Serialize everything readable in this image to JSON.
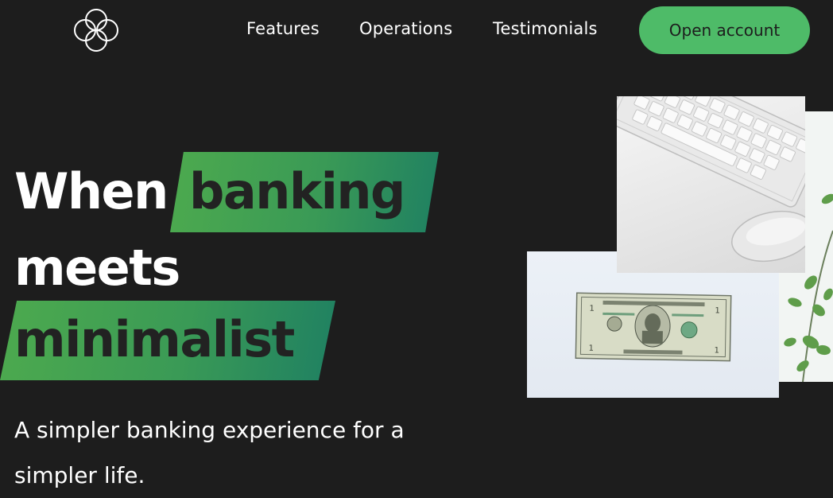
{
  "nav": {
    "logo_icon": "four-petal-logo-icon",
    "links": [
      "Features",
      "Operations",
      "Testimonials"
    ],
    "cta_label": "Open account"
  },
  "hero": {
    "word1": "When",
    "word2": "banking",
    "word3": "meets",
    "word4": "minimalist",
    "subtitle": "A simpler banking experience for a simpler life.",
    "accent_gradient": [
      "#4daa4e",
      "#1f8062"
    ]
  },
  "images": [
    "keyboard-mouse-photo",
    "dollar-bill-photo",
    "plant-leaves-photo"
  ],
  "colors": {
    "background": "#1d1d1d",
    "accent_green": "#4ebb68",
    "text": "#ffffff",
    "dark_text": "#222222"
  }
}
